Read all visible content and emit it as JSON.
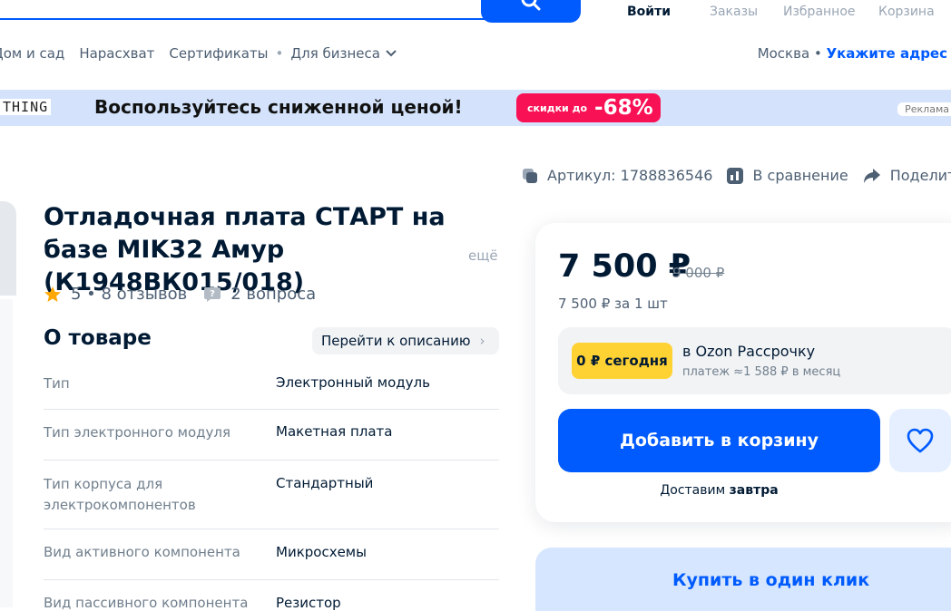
{
  "header": {
    "login": "Войти",
    "orders": "Заказы",
    "favorites": "Избранное",
    "cart": "Корзина",
    "search_icon": "search-icon"
  },
  "nav": {
    "items": [
      "Дом и сад",
      "Нарасхват",
      "Сертификаты"
    ],
    "business": "Для бизнеса",
    "city": "Москва",
    "address": "Укажите адрес"
  },
  "banner": {
    "brand": "THING",
    "headline": "Воспользуйтесь сниженной ценой!",
    "sale_small": "скидки до",
    "sale_big": "-68%",
    "ad_label": "Реклама"
  },
  "actions": {
    "article": "Артикул: 1788836546",
    "compare": "В сравнение",
    "share": "Поделиться"
  },
  "product": {
    "title": "Отладочная плата СТАРТ на базе MIK32 Амур (К1948ВК015/018)",
    "more": "ещё",
    "rating": "5 • 8 отзывов",
    "questions": "2 вопроса"
  },
  "about": {
    "title": "О товаре",
    "goto": "Перейти к описанию",
    "specs": [
      {
        "k": "Тип",
        "v": "Электронный модуль"
      },
      {
        "k": "Тип электронного модуля",
        "v": "Макетная плата"
      },
      {
        "k": "Тип корпуса для электрокомпонентов",
        "v": "Стандартный"
      },
      {
        "k": "Вид активного компонента",
        "v": "Микросхемы"
      },
      {
        "k": "Вид пассивного компонента",
        "v": "Резистор"
      }
    ]
  },
  "price": {
    "current": "7 500 ₽",
    "old": "9 000 ₽",
    "unit": "7 500 ₽ за 1 шт",
    "installment_badge": "0 ₽ сегодня",
    "installment_title": "в Ozon Рассрочку",
    "installment_sub": "платеж ≈1 588 ₽ в месяц",
    "add_to_cart": "Добавить в корзину",
    "delivery_prefix": "Доставим",
    "delivery_day": "завтра",
    "one_click": "Купить в один клик"
  },
  "colors": {
    "accent": "#005bff",
    "sale": "#f91155",
    "badge": "#ffd233",
    "star": "#ffa800"
  }
}
